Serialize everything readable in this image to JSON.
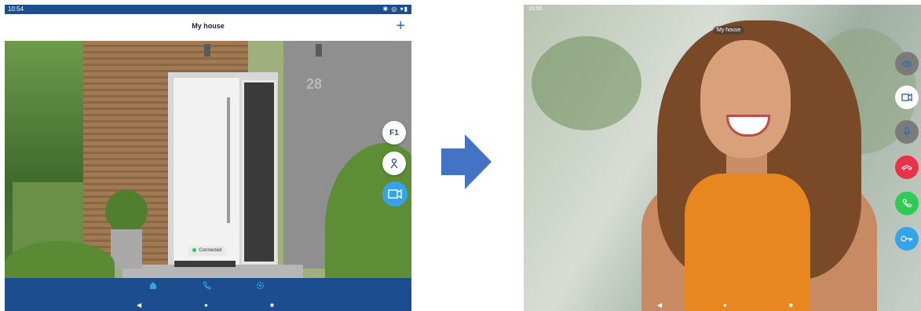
{
  "left_screen": {
    "status": {
      "time": "10:54",
      "icons": "✱ ◎ ▾▮"
    },
    "header": {
      "title": "My house",
      "add_label": "+"
    },
    "scene": {
      "house_number": "28"
    },
    "buttons": {
      "f1_label": "F1"
    },
    "connection": {
      "label": "Connected",
      "status_color": "#2ecc55"
    },
    "bottom_nav": {
      "items": [
        "home-icon",
        "phone-history-icon",
        "settings-icon"
      ],
      "system": [
        "◀",
        "●",
        "■"
      ]
    }
  },
  "right_screen": {
    "status": {
      "time": "10:55"
    },
    "chip_label": "My house",
    "buttons": [
      "eye-icon",
      "switch-camera-icon",
      "mic-icon",
      "hang-up-icon",
      "answer-icon",
      "key-icon"
    ],
    "button_colors": {
      "hangup": "#e8324a",
      "answer": "#2ecc55",
      "key": "#35a3e8"
    },
    "system": [
      "◀",
      "●",
      "■"
    ]
  },
  "colors": {
    "brand_blue": "#1b4d8f",
    "accent_blue": "#35a3e8",
    "arrow_blue": "#4472c4"
  }
}
